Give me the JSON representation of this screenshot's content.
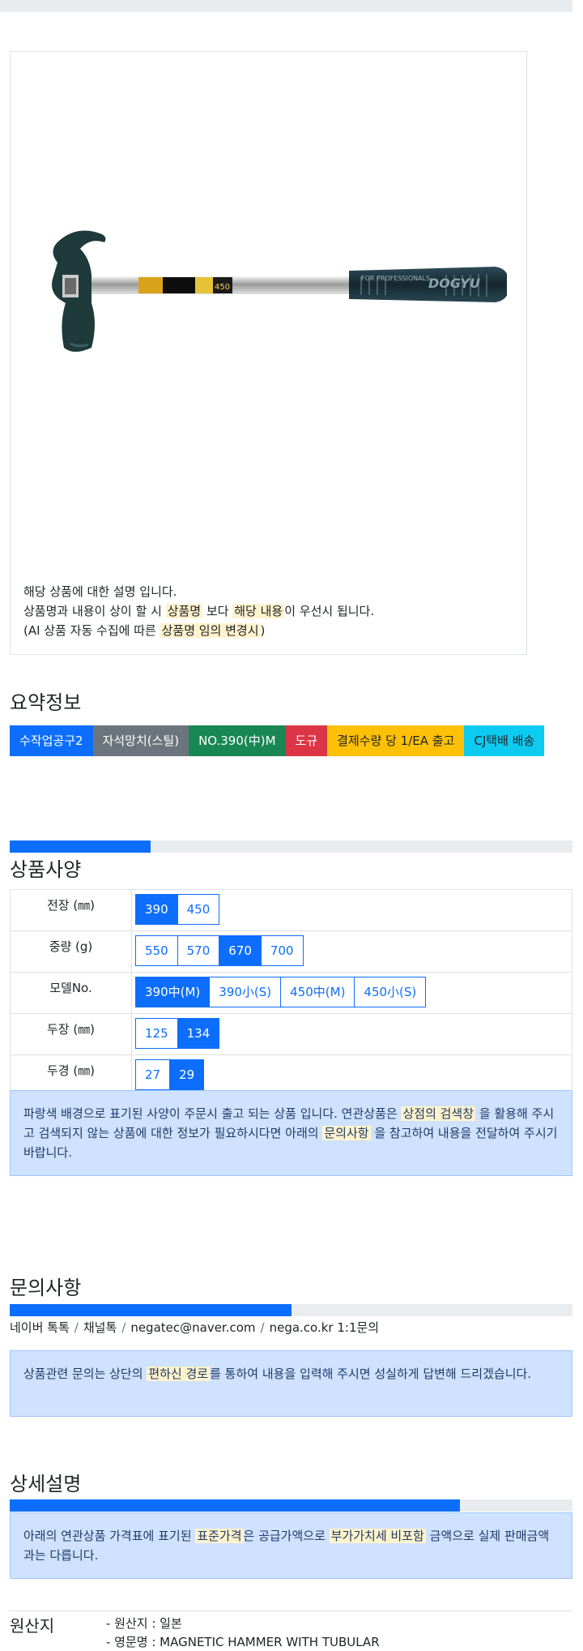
{
  "product_description": {
    "line1": "해당 상품에 대한 설명 입니다.",
    "line2_pre": "상품명과 내용이 상이 할 시",
    "line2_hl1": "상품명",
    "line2_mid": "보다",
    "line2_hl2": "해당 내용",
    "line2_post": "이 우선시 됩니다.",
    "line3_pre": "(AI 상품 자동 수집에 따른",
    "line3_hl": "상품명 임의 변경시",
    "line3_post": ")"
  },
  "summary": {
    "title": "요약정보",
    "badges": [
      {
        "label": "수작업공구2",
        "color": "#0d6efd"
      },
      {
        "label": "자석망치(스틸)",
        "color": "#6c757d"
      },
      {
        "label": "NO.390(中)M",
        "color": "#198754"
      },
      {
        "label": "도규",
        "color": "#dc3545"
      },
      {
        "label": "결제수량 당 1/EA 출고",
        "color": "#ffc107"
      },
      {
        "label": "CJ택배 배송",
        "color": "#0dcaf0"
      }
    ]
  },
  "spec": {
    "title": "상품사양",
    "progress": 0.25,
    "rows": [
      {
        "label": "전장 (㎜)",
        "options": [
          {
            "text": "390",
            "on": true
          },
          {
            "text": "450",
            "on": false
          }
        ]
      },
      {
        "label": "중량 (g)",
        "options": [
          {
            "text": "550",
            "on": false
          },
          {
            "text": "570",
            "on": false
          },
          {
            "text": "670",
            "on": true
          },
          {
            "text": "700",
            "on": false
          }
        ]
      },
      {
        "label": "모델No.",
        "options": [
          {
            "text": "390中(M)",
            "on": true
          },
          {
            "text": "390小(S)",
            "on": false
          },
          {
            "text": "450中(M)",
            "on": false
          },
          {
            "text": "450小(S)",
            "on": false
          }
        ]
      },
      {
        "label": "두장 (㎜)",
        "options": [
          {
            "text": "125",
            "on": false
          },
          {
            "text": "134",
            "on": true
          }
        ]
      },
      {
        "label": "두경 (㎜)",
        "options": [
          {
            "text": "27",
            "on": false
          },
          {
            "text": "29",
            "on": true
          }
        ]
      }
    ],
    "note_pre": "파랑색 배경으로 표기된 사양이 주문시 출고 되는 상품 입니다. 연관상품은",
    "note_hl1": "상점의 검색창",
    "note_mid": "을 활용해 주시고 검색되지 않는 상품에 대한 정보가 필요하시다면 아래의",
    "note_hl2": "문의사항",
    "note_post": "을 참고하여 내용을 전달하여 주시기 바랍니다."
  },
  "inquiry": {
    "title": "문의사항",
    "progress": 0.5,
    "contacts": [
      "네이버 톡톡",
      "채널톡",
      "negatec@naver.com",
      "nega.co.kr 1:1문의"
    ],
    "sep": "/",
    "note_pre": "상품관련 문의는 상단의",
    "note_hl": "편하신 경로",
    "note_post": "를 통하여 내용을 입력해 주시면 성실하게 답변해 드리겠습니다."
  },
  "detail": {
    "title": "상세설명",
    "progress": 0.8,
    "note_pre": "아래의 연관상품 가격표에 표기된",
    "note_hl1": "표준가격",
    "note_mid": "은 공급가액으로",
    "note_hl2": "부가가치세 비포함",
    "note_post": "금액으로 실제 판매금액과는 다릅니다."
  },
  "origin": {
    "label": "원산지",
    "items": [
      "- 원산지 : 일본",
      "- 영문명 : MAGNETIC HAMMER WITH TUBULAR"
    ]
  },
  "hammer_image": {
    "grip_text": "FOR PROFESSIONALS",
    "brand_text": "DOGYU",
    "size_text": "450"
  }
}
